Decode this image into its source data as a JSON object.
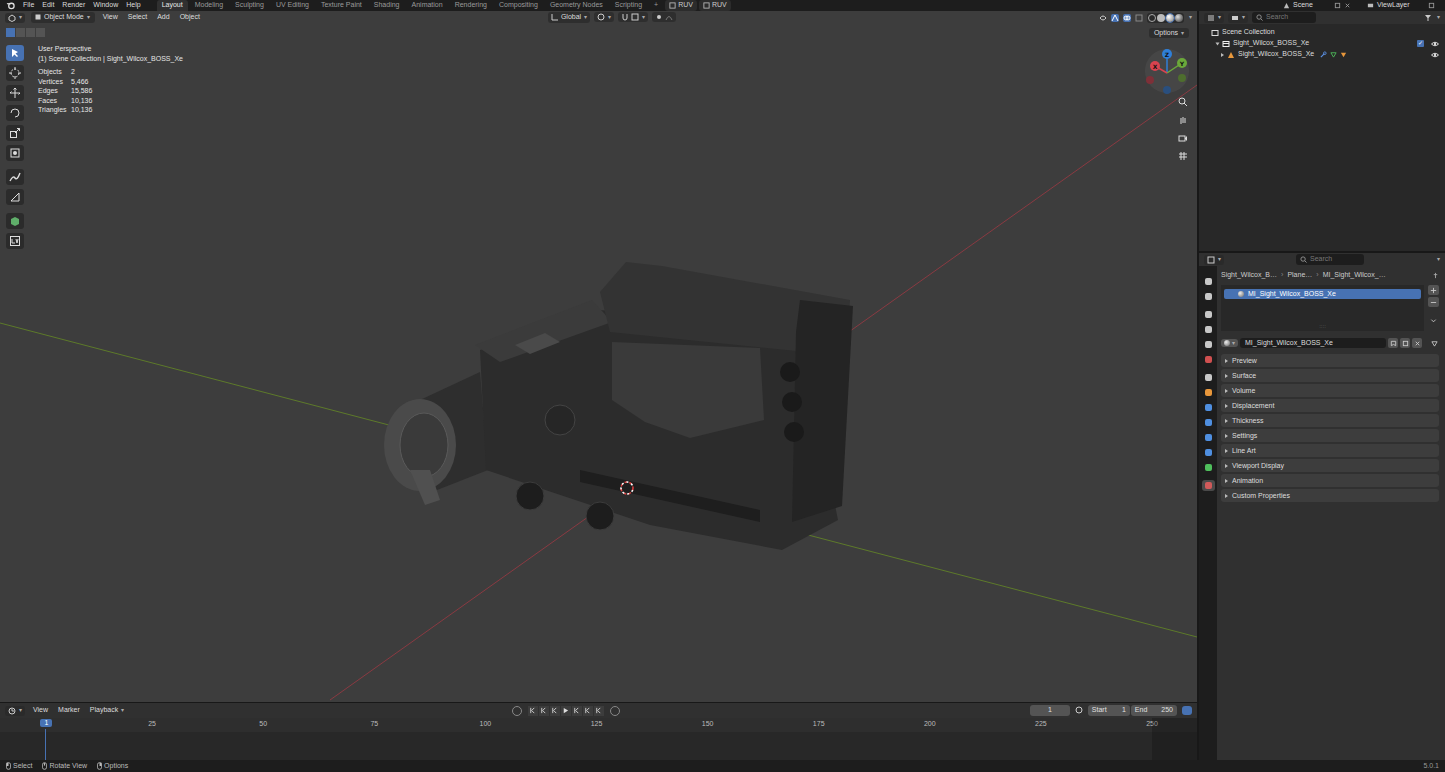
{
  "top_bar": {
    "menus": [
      "File",
      "Edit",
      "Render",
      "Window",
      "Help"
    ],
    "workspaces": [
      {
        "label": "Layout",
        "selected": true
      },
      {
        "label": "Modeling",
        "selected": false
      },
      {
        "label": "Sculpting",
        "selected": false
      },
      {
        "label": "UV Editing",
        "selected": false
      },
      {
        "label": "Texture Paint",
        "selected": false
      },
      {
        "label": "Shading",
        "selected": false
      },
      {
        "label": "Animation",
        "selected": false
      },
      {
        "label": "Rendering",
        "selected": false
      },
      {
        "label": "Compositing",
        "selected": false
      },
      {
        "label": "Geometry Nodes",
        "selected": false
      },
      {
        "label": "Scripting",
        "selected": false
      }
    ],
    "add_workspace": "+",
    "addons": [
      "RUV",
      "RUV"
    ],
    "scene": "Scene",
    "view_layer": "ViewLayer"
  },
  "viewport": {
    "mode": "Object Mode",
    "menus": [
      "View",
      "Select",
      "Add",
      "Object"
    ],
    "orientation": "Global",
    "options": "Options",
    "overlay": {
      "view": "User Perspective",
      "collection": "(1) Scene Collection | Sight_Wilcox_BOSS_Xe",
      "stats": [
        {
          "label": "Objects",
          "value": "2"
        },
        {
          "label": "Vertices",
          "value": "5,466"
        },
        {
          "label": "Edges",
          "value": "15,586"
        },
        {
          "label": "Faces",
          "value": "10,136"
        },
        {
          "label": "Triangles",
          "value": "10,136"
        }
      ]
    },
    "gizmo": [
      {
        "axis": "Z",
        "color": "#2f7fd8"
      },
      {
        "axis": "Y",
        "color": "#6ba93a"
      },
      {
        "axis": "X",
        "color": "#d8434f"
      }
    ],
    "tools": [
      {
        "kind": "select",
        "selected": true
      },
      {
        "kind": "cursor",
        "selected": false
      },
      {
        "kind": "move",
        "selected": false
      },
      {
        "kind": "rotate",
        "selected": false
      },
      {
        "kind": "scale",
        "selected": false
      },
      {
        "kind": "transform",
        "selected": false
      },
      {
        "kind": "annotate",
        "selected": false
      },
      {
        "kind": "measure",
        "selected": false
      },
      {
        "kind": "add-cube",
        "selected": false
      },
      {
        "kind": "uv",
        "selected": false
      }
    ]
  },
  "outliner": {
    "search": "Search",
    "items": [
      {
        "kind": "scene",
        "label": "Scene Collection",
        "expanded": true,
        "visible": true
      },
      {
        "kind": "collection",
        "label": "Sight_Wilcox_BOSS_Xe",
        "expanded": true,
        "visible": true
      },
      {
        "kind": "object",
        "label": "Sight_Wilcox_BOSS_Xe",
        "expanded": false,
        "visible": true
      }
    ]
  },
  "properties": {
    "search": "Search",
    "tabs": [
      {
        "color": "#c8c8c8",
        "selected": false
      },
      {
        "color": "#c8c8c8",
        "selected": false
      },
      {
        "color": "#c8c8c8",
        "selected": false
      },
      {
        "color": "#c8c8c8",
        "selected": false
      },
      {
        "color": "#c8c8c8",
        "selected": false
      },
      {
        "color": "#d05050",
        "selected": false
      },
      {
        "color": "#c8c8c8",
        "selected": false
      },
      {
        "color": "#e8973b",
        "selected": false
      },
      {
        "color": "#4f8fe0",
        "selected": false
      },
      {
        "color": "#4f8fe0",
        "selected": false
      },
      {
        "color": "#4f8fe0",
        "selected": false
      },
      {
        "color": "#4f8fe0",
        "selected": false
      },
      {
        "color": "#4fbf5c",
        "selected": false
      },
      {
        "color": "#d05a5a",
        "selected": true
      }
    ],
    "breadcrumb": [
      "Sight_Wilcox_B…",
      "Plane…",
      "MI_Sight_Wilcox_…"
    ],
    "slots": [
      {
        "label": "MI_Sight_Wilcox_BOSS_Xe",
        "selected": true
      }
    ],
    "material": "MI_Sight_Wilcox_BOSS_Xe",
    "panels": [
      {
        "label": "Preview",
        "expanded": false
      },
      {
        "label": "Surface",
        "expanded": false
      },
      {
        "label": "Volume",
        "expanded": false
      },
      {
        "label": "Displacement",
        "expanded": false
      },
      {
        "label": "Thickness",
        "expanded": false
      },
      {
        "label": "Settings",
        "expanded": false
      },
      {
        "label": "Line Art",
        "expanded": false
      },
      {
        "label": "Viewport Display",
        "expanded": false
      },
      {
        "label": "Animation",
        "expanded": false
      },
      {
        "label": "Custom Properties",
        "expanded": false
      }
    ]
  },
  "timeline": {
    "menus": [
      "View",
      "Marker",
      "Playback"
    ],
    "frame": "1",
    "start_label": "Start",
    "start": "1",
    "end_label": "End",
    "end": "250",
    "ticks": [
      "25",
      "50",
      "75",
      "100",
      "125",
      "150",
      "175",
      "200",
      "225",
      "250"
    ],
    "playhead": "1"
  },
  "status_bar": {
    "hints": [
      "Select",
      "Rotate View",
      "Options"
    ],
    "version": "5.0.1"
  }
}
